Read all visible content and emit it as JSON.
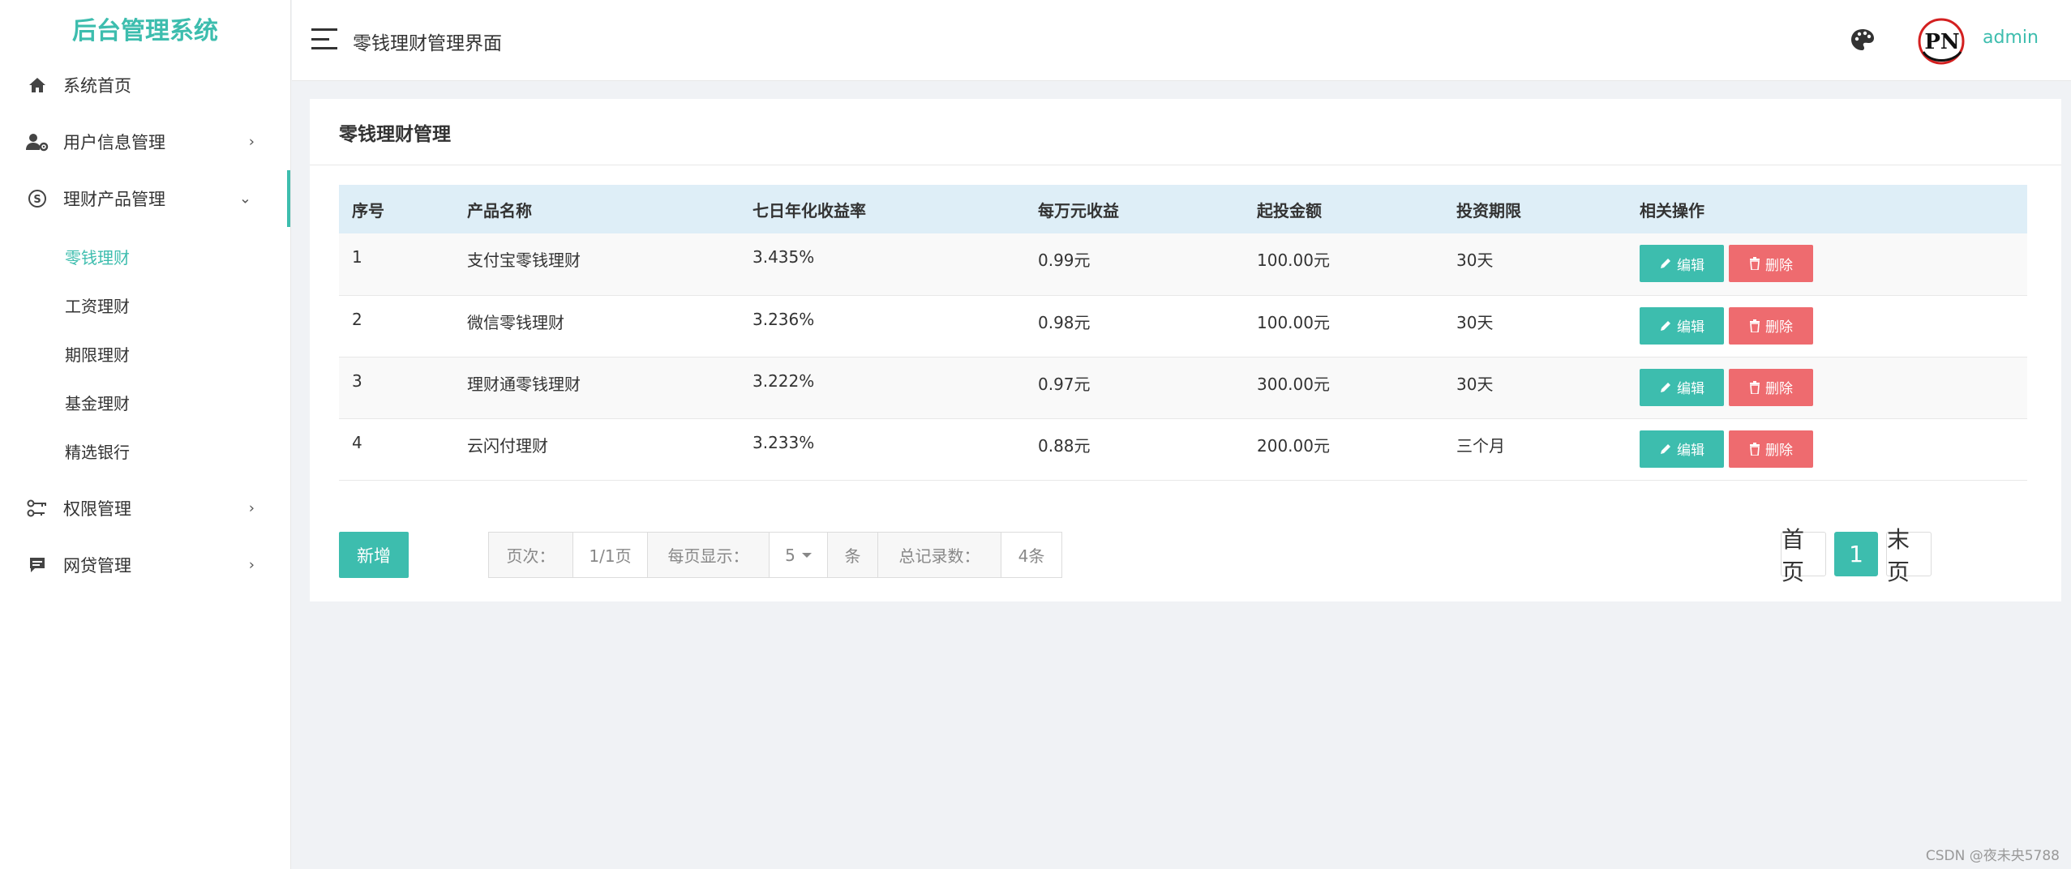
{
  "app": {
    "title": "后台管理系统"
  },
  "sidebar": {
    "items": [
      {
        "label": "系统首页",
        "icon": "home-icon"
      },
      {
        "label": "用户信息管理",
        "icon": "user-gear-icon"
      },
      {
        "label": "理财产品管理",
        "icon": "finance-icon"
      },
      {
        "label": "权限管理",
        "icon": "key-icon"
      },
      {
        "label": "网贷管理",
        "icon": "message-icon"
      }
    ],
    "submenu": [
      {
        "label": "零钱理财"
      },
      {
        "label": "工资理财"
      },
      {
        "label": "期限理财"
      },
      {
        "label": "基金理财"
      },
      {
        "label": "精选银行"
      }
    ]
  },
  "header": {
    "title": "零钱理财管理界面",
    "user": "admin",
    "avatar_text": "PN"
  },
  "card": {
    "title": "零钱理财管理"
  },
  "table": {
    "headers": [
      "序号",
      "产品名称",
      "七日年化收益率",
      "每万元收益",
      "起投金额",
      "投资期限",
      "相关操作"
    ],
    "rows": [
      {
        "no": "1",
        "name": "支付宝零钱理财",
        "rate": "3.435%",
        "income": "0.99元",
        "min": "100.00元",
        "term": "30天"
      },
      {
        "no": "2",
        "name": "微信零钱理财",
        "rate": "3.236%",
        "income": "0.98元",
        "min": "100.00元",
        "term": "30天"
      },
      {
        "no": "3",
        "name": "理财通零钱理财",
        "rate": "3.222%",
        "income": "0.97元",
        "min": "300.00元",
        "term": "30天"
      },
      {
        "no": "4",
        "name": "云闪付理财",
        "rate": "3.233%",
        "income": "0.88元",
        "min": "200.00元",
        "term": "三个月"
      }
    ],
    "edit_label": "编辑",
    "delete_label": "删除"
  },
  "footer": {
    "new_label": "新增",
    "page_label": "页次：",
    "page_value": "1/1页",
    "per_page_label": "每页显示：",
    "per_page_value": "5",
    "per_page_unit": "条",
    "total_label": "总记录数：",
    "total_value": "4条"
  },
  "pagination": {
    "first": "首页",
    "current": "1",
    "last": "末页"
  },
  "watermark": "CSDN @夜未央5788",
  "colors": {
    "accent": "#3dbdae",
    "danger": "#ee6b6f",
    "table_header": "#deeef7"
  }
}
